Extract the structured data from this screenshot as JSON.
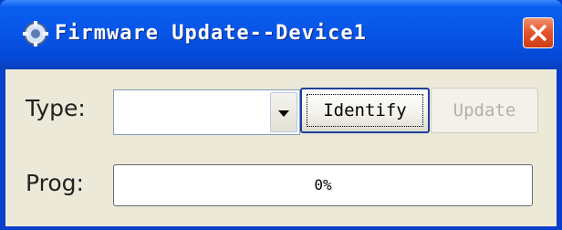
{
  "window": {
    "title": "Firmware Update--Device1",
    "icon": "app-gear-icon",
    "close_icon": "close-icon"
  },
  "form": {
    "type_label": "Type:",
    "type_value": "",
    "identify_label": "Identify",
    "update_label": "Update",
    "progress_label": "Prog:",
    "progress_text": "0%",
    "progress_value": 0
  },
  "colors": {
    "titlebar": "#0754e6",
    "close_button": "#e5572f",
    "client_bg": "#ece9d8",
    "progress_fill": "#2fb32f"
  }
}
